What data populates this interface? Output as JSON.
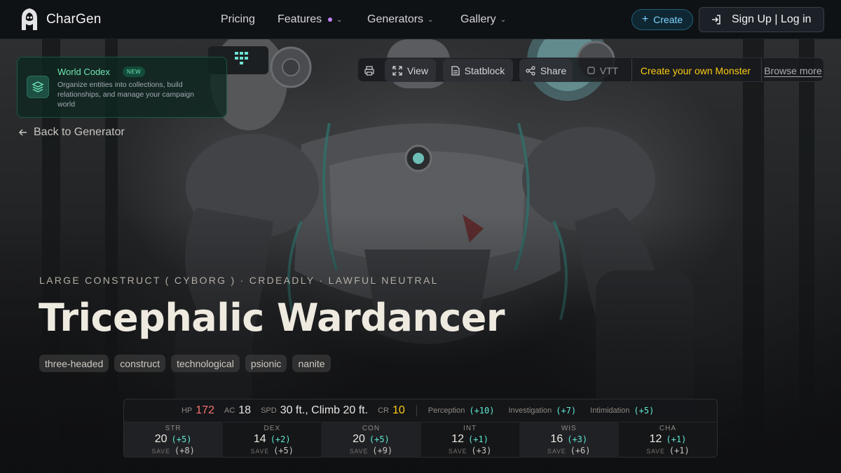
{
  "brand": {
    "name": "CharGen",
    "logo_icon": "hooded-figure-logo-icon"
  },
  "nav": {
    "links": [
      {
        "label": "Pricing",
        "has_dropdown": false
      },
      {
        "label": "Features",
        "has_dropdown": true,
        "indicator_color": "#c084fc"
      },
      {
        "label": "Generators",
        "has_dropdown": true
      },
      {
        "label": "Gallery",
        "has_dropdown": true
      }
    ],
    "create_label": "Create",
    "auth_label": "Sign Up | Log in"
  },
  "codex": {
    "title": "World Codex",
    "badge": "NEW",
    "description": "Organize entities into collections, build relationships, and manage your campaign world",
    "icon": "layers-icon"
  },
  "back_label": "Back to Generator",
  "toolbar": {
    "print_icon": "printer-icon",
    "view_label": "View",
    "statblock_label": "Statblock",
    "share_label": "Share",
    "vtt_label": "VTT",
    "create_monster_label": "Create your own Monster",
    "browse_label": "Browse more"
  },
  "monster": {
    "meta": "LARGE CONSTRUCT ( CYBORG ) · CRDEADLY · LAWFUL NEUTRAL",
    "name": "Tricephalic Wardancer",
    "tags": [
      "three-headed",
      "construct",
      "technological",
      "psionic",
      "nanite"
    ]
  },
  "stats": {
    "hp_label": "HP",
    "hp": "172",
    "ac_label": "AC",
    "ac": "18",
    "spd_label": "SPD",
    "spd": "30 ft., Climb 20 ft.",
    "cr_label": "CR",
    "cr": "10",
    "skills": [
      {
        "name": "Perception",
        "mod": "(+10)"
      },
      {
        "name": "Investigation",
        "mod": "(+7)"
      },
      {
        "name": "Intimidation",
        "mod": "(+5)"
      }
    ],
    "save_label": "SAVE",
    "abilities": [
      {
        "name": "STR",
        "score": "20",
        "mod": "(+5)",
        "save": "(+8)"
      },
      {
        "name": "DEX",
        "score": "14",
        "mod": "(+2)",
        "save": "(+5)"
      },
      {
        "name": "CON",
        "score": "20",
        "mod": "(+5)",
        "save": "(+9)"
      },
      {
        "name": "INT",
        "score": "12",
        "mod": "(+1)",
        "save": "(+3)"
      },
      {
        "name": "WIS",
        "score": "16",
        "mod": "(+3)",
        "save": "(+6)"
      },
      {
        "name": "CHA",
        "score": "12",
        "mod": "(+1)",
        "save": "(+1)"
      }
    ]
  },
  "colors": {
    "accent_teal": "#5eead4",
    "hp_red": "#f87171",
    "cr_yellow": "#facc15",
    "codex_green": "#6ee7b7",
    "create_blue": "#7dd3fc"
  }
}
